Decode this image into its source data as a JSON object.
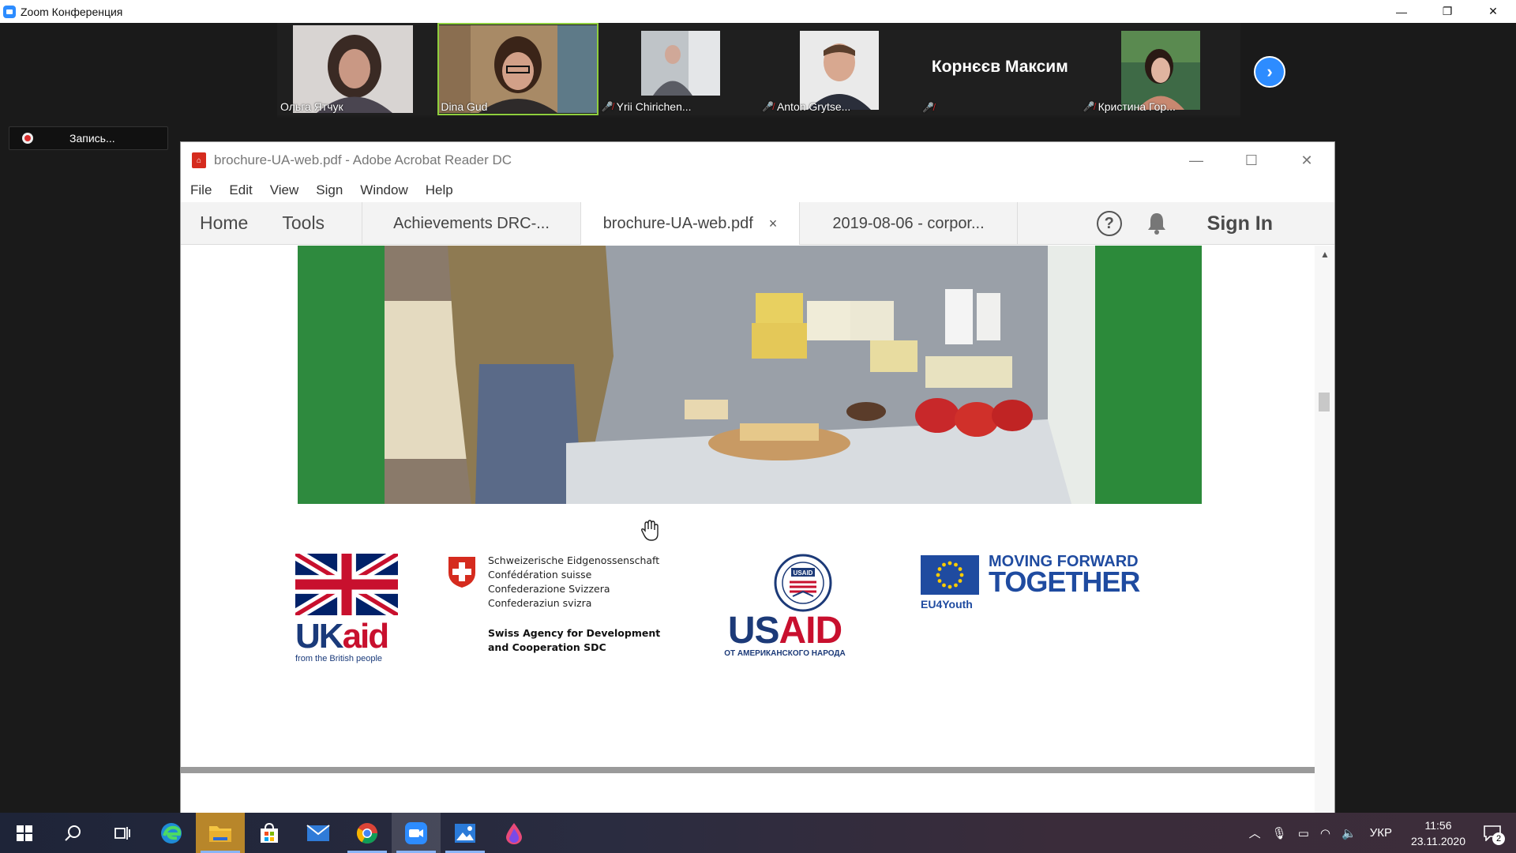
{
  "zoom": {
    "title": "Zoom Конференция",
    "window_controls": {
      "minimize": "—",
      "restore": "❐",
      "close": "✕"
    },
    "participants": [
      {
        "name": "Ольга Ятчук",
        "muted": false,
        "active": false
      },
      {
        "name": "Dina Gud",
        "muted": false,
        "active": true
      },
      {
        "name": "Yrii Chirichen...",
        "muted": true,
        "active": false
      },
      {
        "name": "Anton Grytse...",
        "muted": true,
        "active": false
      },
      {
        "name": "Корнєєв Максим",
        "muted": true,
        "active": false,
        "no_video": true
      },
      {
        "name": "Кристина Гор...",
        "muted": true,
        "active": false
      }
    ],
    "recording_label": "Запись..."
  },
  "acrobat": {
    "title": "brochure-UA-web.pdf - Adobe Acrobat Reader DC",
    "menu": [
      "File",
      "Edit",
      "View",
      "Sign",
      "Window",
      "Help"
    ],
    "nav": {
      "home": "Home",
      "tools": "Tools"
    },
    "tabs": [
      {
        "label": "Achievements DRC-...",
        "active": false
      },
      {
        "label": "brochure-UA-web.pdf",
        "active": true,
        "close": "×"
      },
      {
        "label": "2019-08-06 - corpor...",
        "active": false
      }
    ],
    "sign_in": "Sign In",
    "help_glyph": "?"
  },
  "logos": {
    "ukaid": {
      "top": "UK",
      "bold": "aid",
      "tagline": "from the British people"
    },
    "swiss": {
      "lines": [
        "Schweizerische Eidgenossenschaft",
        "Confédération suisse",
        "Confederazione Svizzera",
        "Confederaziun svizra"
      ],
      "agency": [
        "Swiss Agency for Development",
        "and Cooperation SDC"
      ]
    },
    "usaid": {
      "seal": "USAID",
      "name": "USAID",
      "tagline": "ОТ АМЕРИКАНСКОГО НАРОДА"
    },
    "eu": {
      "line1": "MOVING FORWARD",
      "line2": "TOGETHER",
      "tag": "EU4Youth"
    }
  },
  "taskbar": {
    "language": "УКР",
    "time": "11:56",
    "date": "23.11.2020",
    "notifications": "2",
    "colors": {
      "accent": "#8ab4f8"
    }
  }
}
